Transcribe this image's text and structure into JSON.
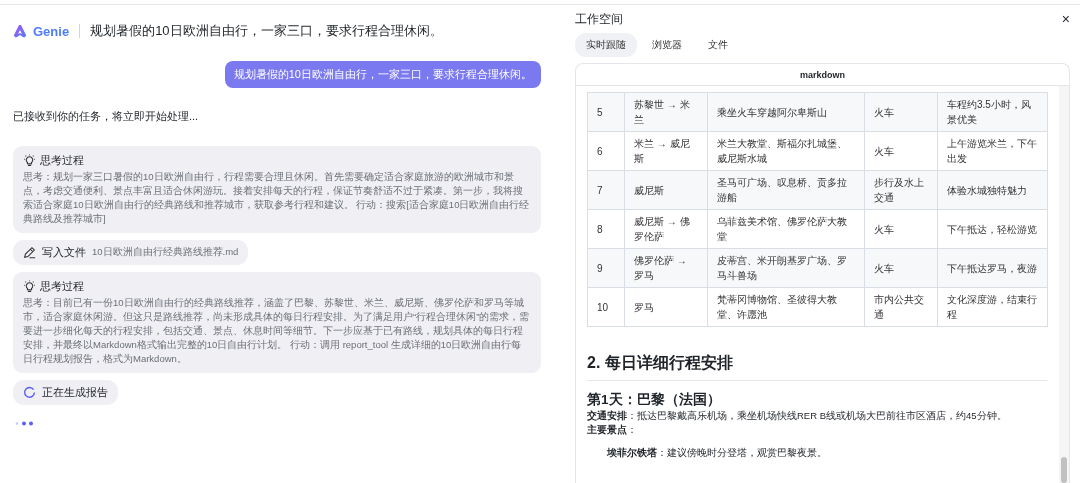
{
  "header": {
    "brand": "Genie",
    "title": "规划暑假的10日欧洲自由行，一家三口，要求行程合理休闲。"
  },
  "chat": {
    "user_message": "规划暑假的10日欧洲自由行，一家三口，要求行程合理休闲。",
    "reply": "已接收到你的任务，将立即开始处理...",
    "steps": [
      {
        "kind": "thought",
        "title": "思考过程",
        "text": "思考：规划一家三口暑假的10日欧洲自由行，行程需要合理且休闲。首先需要确定适合家庭旅游的欧洲城市和景点，考虑交通便利、景点丰富且适合休闲游玩。接着安排每天的行程，保证节奏舒适不过于紧凑。第一步，我将搜索适合家庭10日欧洲自由行的经典路线和推荐城市，获取参考行程和建议。 行动：搜索[适合家庭10日欧洲自由行经典路线及推荐城市]"
      },
      {
        "kind": "file",
        "action": "写入文件",
        "file": "10日欧洲自由行经典路线推荐.md"
      },
      {
        "kind": "thought",
        "title": "思考过程",
        "text": "思考：目前已有一份10日欧洲自由行的经典路线推荐，涵盖了巴黎、苏黎世、米兰、威尼斯、佛罗伦萨和罗马等城市，适合家庭休闲游。但这只是路线推荐，尚未形成具体的每日行程安排。为了满足用户“行程合理休闲”的需求，需要进一步细化每天的行程安排，包括交通、景点、休息时间等细节。下一步应基于已有路线，规划具体的每日行程安排，并最终以Markdown格式输出完整的10日自由行计划。 行动：调用 report_tool 生成详细的10日欧洲自由行每日行程规划报告，格式为Markdown。"
      },
      {
        "kind": "status",
        "label": "正在生成报告"
      }
    ]
  },
  "workspace": {
    "title": "工作空间",
    "close": "×",
    "tabs": [
      {
        "label": "实时跟随",
        "selected": true
      },
      {
        "label": "浏览器",
        "selected": false
      },
      {
        "label": "文件",
        "selected": false
      }
    ],
    "doc": {
      "label": "markdown",
      "table_rows": [
        [
          "5",
          "苏黎世 → 米兰",
          "乘坐火车穿越阿尔卑斯山",
          "火车",
          "车程约3.5小时，风景优美"
        ],
        [
          "6",
          "米兰 → 威尼斯",
          "米兰大教堂、斯福尔扎城堡、威尼斯水城",
          "火车",
          "上午游览米兰，下午出发"
        ],
        [
          "7",
          "威尼斯",
          "圣马可广场、叹息桥、贡多拉游船",
          "步行及水上交通",
          "体验水城独特魅力"
        ],
        [
          "8",
          "威尼斯 → 佛罗伦萨",
          "乌菲兹美术馆、佛罗伦萨大教堂",
          "火车",
          "下午抵达，轻松游览"
        ],
        [
          "9",
          "佛罗伦萨 → 罗马",
          "皮蒂宫、米开朗基罗广场、罗马斗兽场",
          "火车",
          "下午抵达罗马，夜游"
        ],
        [
          "10",
          "罗马",
          "梵蒂冈博物馆、圣彼得大教堂、许愿池",
          "市内公共交通",
          "文化深度游，结束行程"
        ]
      ],
      "heading": "2. 每日详细行程安排",
      "subheading": "第1天：巴黎（法国）",
      "paragraphs": [
        "**交通安排**：抵达巴黎戴高乐机场，乘坐机场快线RER B线或机场大巴前往市区酒店，约45分钟。",
        "**主要景点**："
      ],
      "list": [
        "**埃菲尔铁塔**：建议傍晚时分登塔，观赏巴黎夜景。"
      ]
    }
  }
}
